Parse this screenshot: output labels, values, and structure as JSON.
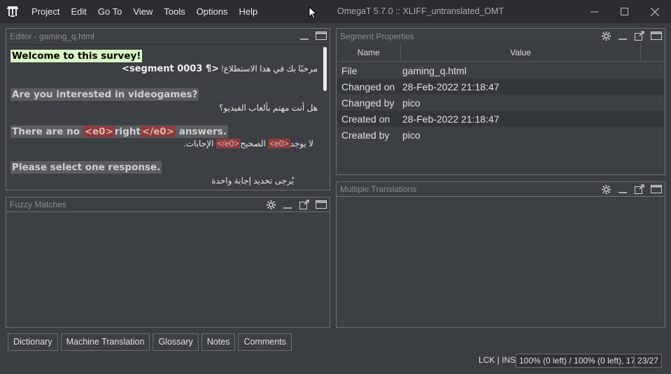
{
  "titlebar": {
    "menu": [
      "Project",
      "Edit",
      "Go To",
      "View",
      "Tools",
      "Options",
      "Help"
    ],
    "window_title": "OmegaT 5.7.0 :: XLIFF_untranslated_OMT",
    "controls": [
      "minimize-icon",
      "maximize-icon",
      "close-icon"
    ]
  },
  "editor": {
    "title": "Editor - gaming_q.html",
    "segments": [
      {
        "source": "Welcome to this survey!",
        "target_prefix": "مرحبًا بك في هذا الاستطلاع!",
        "marker": "<segment 0003 ¶>",
        "active": true
      },
      {
        "source": "Are you interested in videogames?",
        "target": "هل أنت مهتم بألعاب الفيديو؟"
      },
      {
        "source_parts": [
          "There are no ",
          "<e0>",
          "right",
          "</e0>",
          " answers."
        ],
        "target_parts": [
          "لا يوجد",
          "<e0>",
          " الصحيح",
          "</e0>",
          " الإجابات."
        ]
      },
      {
        "source": "Please select one response.",
        "target": "يُرجى تحديد إجابة واحدة"
      }
    ]
  },
  "fuzzy": {
    "title": "Fuzzy Matches"
  },
  "props": {
    "title": "Segment Properties",
    "col_name": "Name",
    "col_value": "Value",
    "rows": [
      {
        "name": "File",
        "value": "gaming_q.html"
      },
      {
        "name": "Changed on",
        "value": "28-Feb-2022 21:18:47"
      },
      {
        "name": "Changed by",
        "value": "pico"
      },
      {
        "name": "Created on",
        "value": "28-Feb-2022 21:18:47"
      },
      {
        "name": "Created by",
        "value": "pico"
      }
    ]
  },
  "multi": {
    "title": "Multiple Translations"
  },
  "tabs": [
    "Dictionary",
    "Machine Translation",
    "Glossary",
    "Notes",
    "Comments"
  ],
  "status": {
    "mode": "LCK | INS",
    "progress": "100% (0 left) / 100% (0 left), 17",
    "count": "23/27"
  }
}
